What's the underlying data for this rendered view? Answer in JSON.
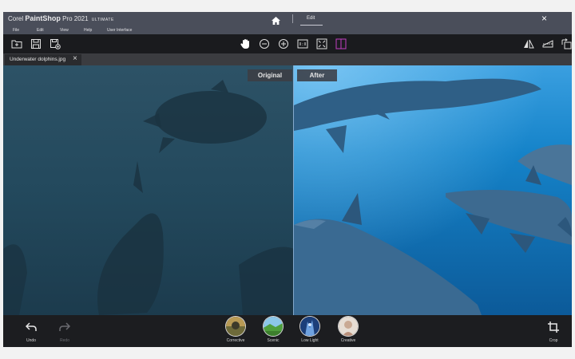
{
  "window": {
    "title_prefix": "Corel",
    "title_brand": "PaintShop",
    "title_suffix": "Pro 2021",
    "title_edition": "ULTIMATE",
    "mode_tab": "Edit",
    "close_glyph": "×"
  },
  "menu": {
    "items": [
      "File",
      "Edit",
      "View",
      "Help",
      "User Interface"
    ]
  },
  "toolbar": {
    "left_icons": [
      "open-file-icon",
      "save-icon",
      "save-as-icon"
    ],
    "view_icons": [
      "pan-hand-icon",
      "zoom-out-icon",
      "zoom-in-icon",
      "actual-size-icon",
      "fit-window-icon",
      "split-compare-icon"
    ],
    "right_icons": [
      "flip-icon",
      "straighten-icon",
      "rotate-icon"
    ]
  },
  "document_tab": {
    "label": "Underwater dolphins.jpg",
    "close_glyph": "×"
  },
  "canvas": {
    "label_before": "Original",
    "label_after": "After"
  },
  "bottom": {
    "undo_label": "Undo",
    "redo_label": "Redo",
    "crop_label": "Crop",
    "presets": [
      {
        "label": "Corrective"
      },
      {
        "label": "Scenic"
      },
      {
        "label": "Low Light"
      },
      {
        "label": "Creative"
      }
    ]
  },
  "colors": {
    "accent_split_icon": "#c23fc2",
    "water_after": "#1583c9",
    "water_before": "#23495d"
  }
}
